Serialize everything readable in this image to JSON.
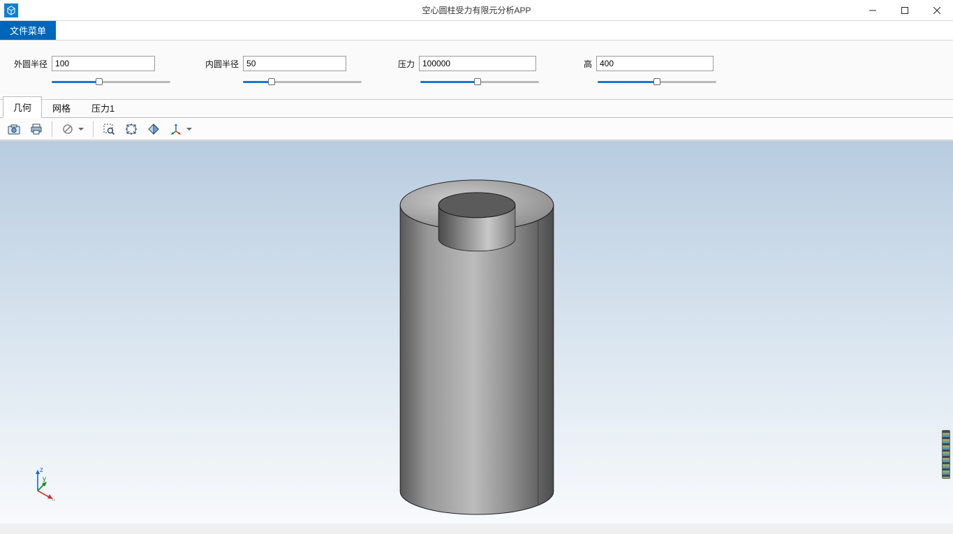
{
  "window": {
    "title": "空心圆柱受力有限元分析APP"
  },
  "menu": {
    "file": "文件菜单"
  },
  "params": {
    "outer_radius": {
      "label": "外圆半径",
      "value": "100",
      "slider_pct": 40
    },
    "inner_radius": {
      "label": "内圆半径",
      "value": "50",
      "slider_pct": 24
    },
    "pressure": {
      "label": "压力",
      "value": "100000",
      "slider_pct": 48
    },
    "height": {
      "label": "高",
      "value": "400",
      "slider_pct": 50
    }
  },
  "tabs": {
    "geometry": "几何",
    "mesh": "网格",
    "pressure": "压力1",
    "active": "geometry"
  },
  "axis": {
    "z": "z",
    "y": "y",
    "x": "x"
  }
}
